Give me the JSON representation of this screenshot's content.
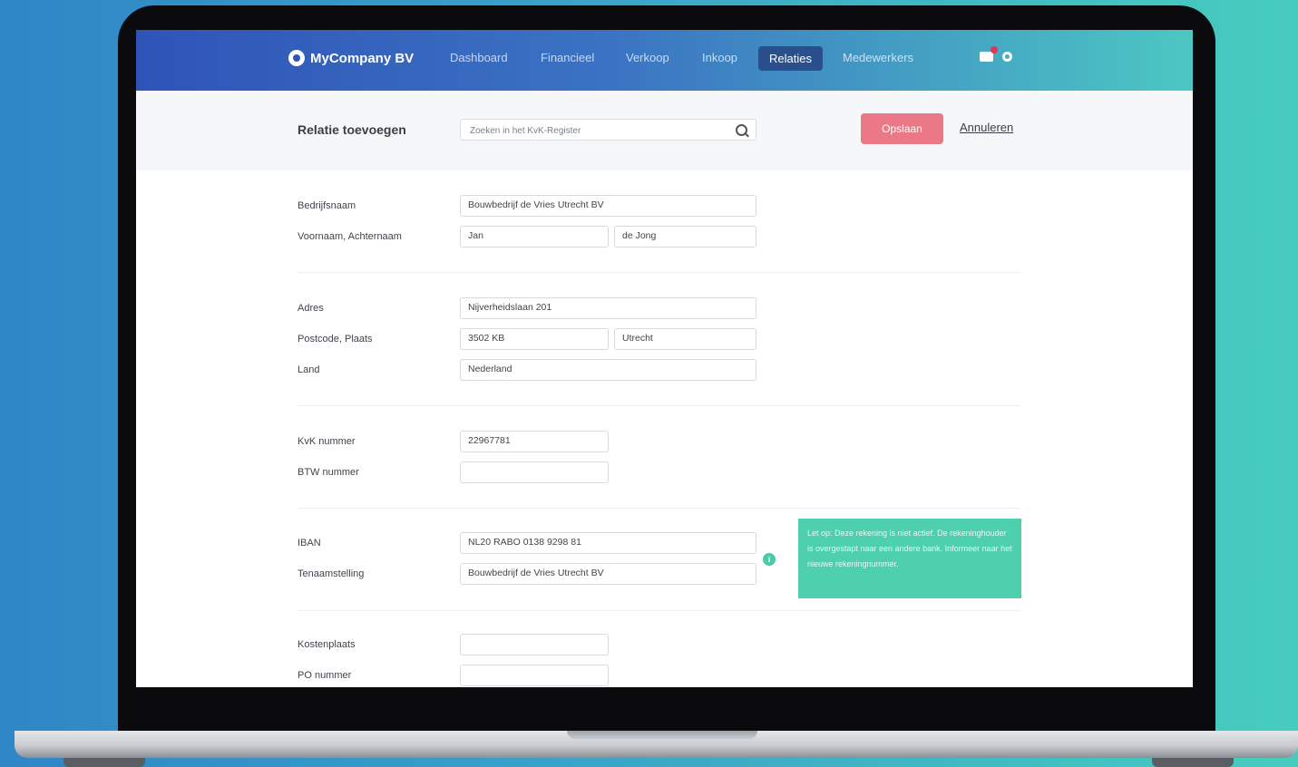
{
  "nav": {
    "brand": "MyCompany BV",
    "items": [
      "Dashboard",
      "Financieel",
      "Verkoop",
      "Inkoop",
      "Relaties",
      "Medewerkers"
    ],
    "active": "Relaties"
  },
  "header": {
    "title": "Relatie toevoegen",
    "search_placeholder": "Zoeken in het KvK-Register",
    "save_label": "Opslaan",
    "cancel_label": "Annuleren"
  },
  "form": {
    "bedrijfsnaam": {
      "label": "Bedrijfsnaam",
      "value": "Bouwbedrijf de Vries Utrecht BV"
    },
    "naam": {
      "label": "Voornaam, Achternaam",
      "first": "Jan",
      "last": "de Jong"
    },
    "adres": {
      "label": "Adres",
      "value": "Nijverheidslaan 201"
    },
    "postcode_plaats": {
      "label": "Postcode, Plaats",
      "postcode": "3502 KB",
      "plaats": "Utrecht"
    },
    "land": {
      "label": "Land",
      "value": "Nederland"
    },
    "kvk": {
      "label": "KvK nummer",
      "value": "22967781"
    },
    "btw": {
      "label": "BTW nummer",
      "value": ""
    },
    "iban": {
      "label": "IBAN",
      "value": "NL20 RABO 0138 9298 81"
    },
    "tenaamstelling": {
      "label": "Tenaamstelling",
      "value": "Bouwbedrijf de Vries Utrecht BV"
    },
    "kostenplaats": {
      "label": "Kostenplaats",
      "value": ""
    },
    "po": {
      "label": "PO nummer",
      "value": ""
    }
  },
  "tooltip": {
    "text": "Let op: Deze rekening is niet actief. De rekeninghouder is overgestapt naar een andere bank. Informeer naar het nieuwe rekeningnummer."
  },
  "colors": {
    "nav_start": "#2f54b8",
    "nav_end": "#4cc7c3",
    "save_button": "#eb7886",
    "tooltip": "#4ecfae"
  }
}
